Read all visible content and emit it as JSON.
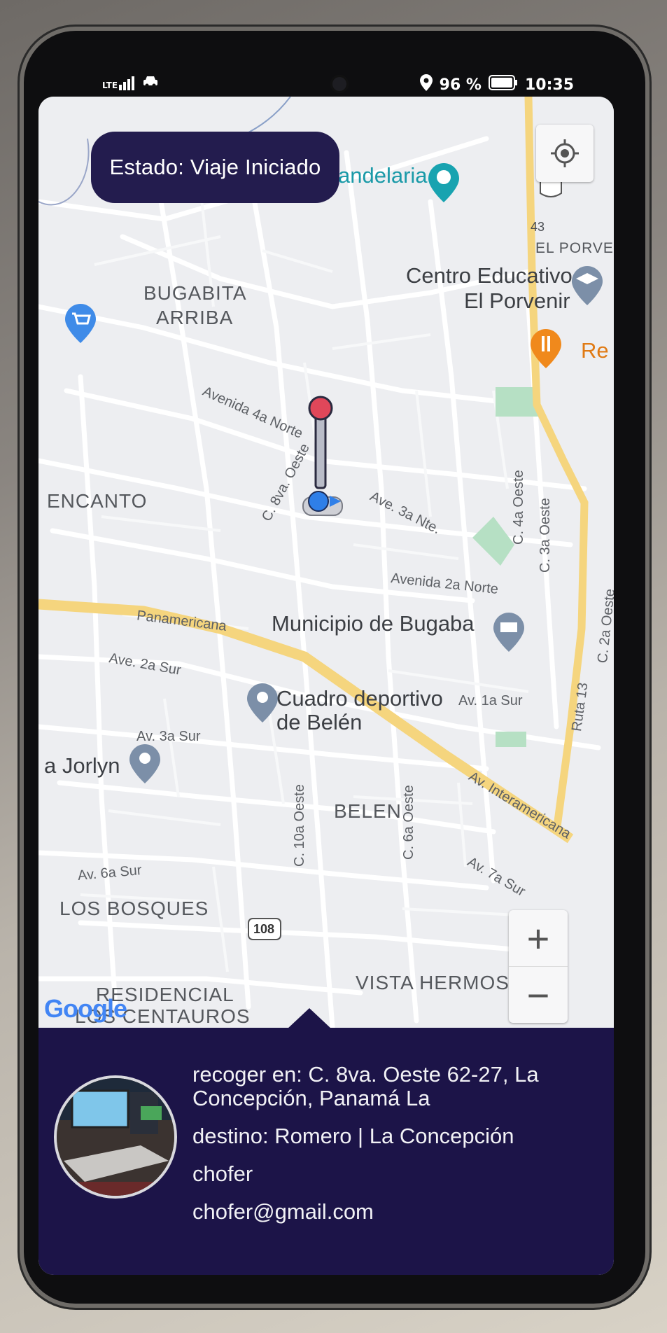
{
  "status_bar": {
    "network": "LTE",
    "battery": "96 %",
    "time": "10:35"
  },
  "trip_status": "Estado: Viaje Iniciado",
  "map": {
    "places": {
      "candelaria": "andelaria",
      "centro_educativo_1": "Centro Educativo",
      "centro_educativo_2": "El Porvenir",
      "el_porvenir": "EL PORVEN",
      "restaurant": "Re",
      "bugabita_1": "BUGABITA",
      "bugabita_2": "ARRIBA",
      "encanto": "ENCANTO",
      "municipio": "Municipio de Bugaba",
      "cuadro_1": "Cuadro deportivo",
      "cuadro_2": "de Belén",
      "jorlyn": "a Jorlyn",
      "belen": "BELEN",
      "los_bosques": "LOS BOSQUES",
      "residencial_1": "RESIDENCIAL",
      "residencial_2": "LOS CENTAUROS",
      "vista_hermosa": "VISTA HERMOSA"
    },
    "roads": {
      "avenida_4a_norte": "Avenida 4a Norte",
      "ave_3a_nte": "Ave. 3a Nte.",
      "c_8va_oeste": "C. 8va. Oeste",
      "c_4a_oeste": "C. 4a Oeste",
      "c_3a_oeste": "C. 3a Oeste",
      "avenida_2a_norte": "Avenida 2a Norte",
      "panamericana": "Panamericana",
      "ave_2a_sur": "Ave. 2a Sur",
      "av_1a_sur": "Av. 1a Sur",
      "av_3a_sur": "Av. 3a Sur",
      "ruta13": "Ruta 13",
      "c_2a_oeste": "C. 2a Oeste",
      "av_interamericana": "Av. Interamericana",
      "c_10a_oeste": "C. 10a Oeste",
      "c_6a_oeste": "C. 6a Oeste",
      "av_6a_sur": "Av. 6a Sur",
      "av_7a_sur": "Av. 7a Sur",
      "route_43": "43",
      "route_108": "108"
    },
    "zoom_in": "+",
    "zoom_out": "−",
    "attribution": "Google"
  },
  "trip_panel": {
    "pickup": "recoger en: C. 8va. Oeste 62-27, La Concepción, Panamá La",
    "destination": "destino: Romero | La Concepción",
    "driver_label": "chofer",
    "driver_email": "chofer@gmail.com"
  },
  "colors": {
    "panel": "#1c1448",
    "chip": "#231c4e",
    "highway": "#f5d57e",
    "marker_red": "#e0475a",
    "marker_blue": "#2f7fe8"
  },
  "icons": [
    "signal-icon",
    "car-icon",
    "location-pin-icon",
    "battery-icon",
    "my-location-icon",
    "shopping-cart-icon",
    "school-icon",
    "restaurant-icon",
    "municipality-icon",
    "place-pin-icon",
    "tree-icon"
  ]
}
